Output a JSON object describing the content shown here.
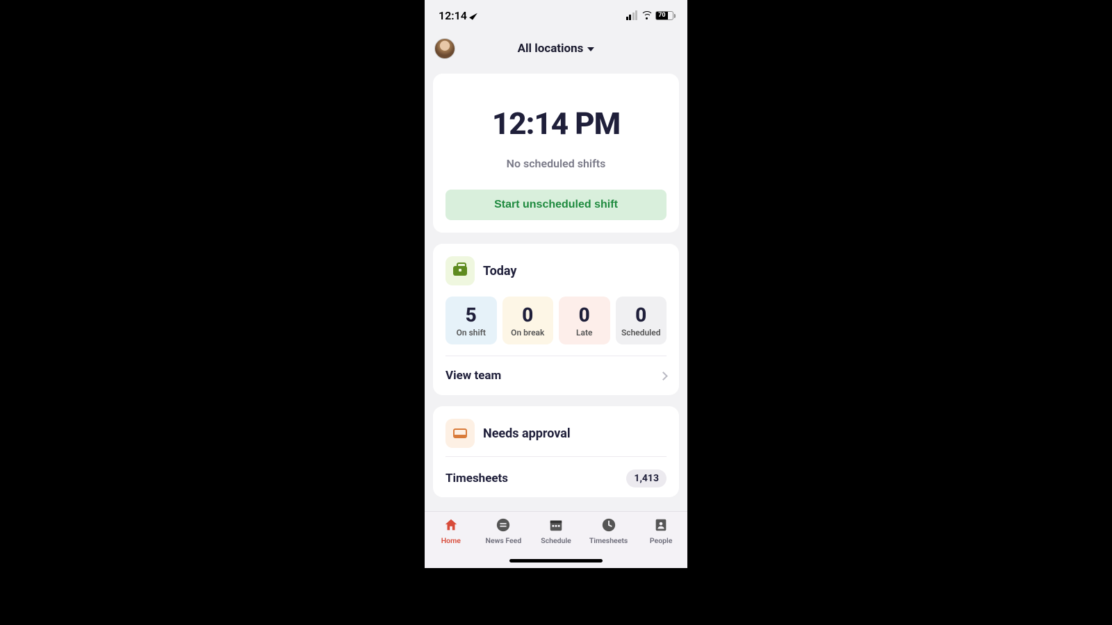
{
  "status_bar": {
    "time": "12:14",
    "battery": "70"
  },
  "header": {
    "location_label": "All locations"
  },
  "clock_card": {
    "time": "12:14 PM",
    "status": "No scheduled shifts",
    "start_button": "Start unscheduled shift"
  },
  "today": {
    "title": "Today",
    "stats": {
      "on_shift": {
        "value": "5",
        "label": "On shift"
      },
      "on_break": {
        "value": "0",
        "label": "On break"
      },
      "late": {
        "value": "0",
        "label": "Late"
      },
      "scheduled": {
        "value": "0",
        "label": "Scheduled"
      }
    },
    "view_team": "View team"
  },
  "approval": {
    "title": "Needs approval",
    "timesheets_label": "Timesheets",
    "timesheets_count": "1,413"
  },
  "tabs": {
    "home": "Home",
    "news": "News Feed",
    "schedule": "Schedule",
    "timesheets": "Timesheets",
    "people": "People"
  }
}
